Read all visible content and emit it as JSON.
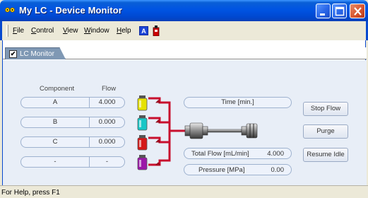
{
  "window": {
    "title": "My LC - Device Monitor"
  },
  "menu": {
    "items": [
      "File",
      "Control",
      "View",
      "Window",
      "Help"
    ],
    "icon1_glyph": "A"
  },
  "tab": {
    "label": "LC Monitor",
    "checked": true
  },
  "monitor": {
    "headers": {
      "component": "Component",
      "flow": "Flow"
    },
    "rows": [
      {
        "component": "A",
        "flow": "4.000",
        "color": "#e6e200"
      },
      {
        "component": "B",
        "flow": "0.000",
        "color": "#18c7c7"
      },
      {
        "component": "C",
        "flow": "0.000",
        "color": "#d41818"
      },
      {
        "component": "-",
        "flow": "-",
        "color": "#9b18a8"
      }
    ],
    "time_label": "Time [min.]",
    "total_flow_label": "Total Flow [mL/min]",
    "total_flow_value": "4.000",
    "pressure_label": "Pressure [MPa]",
    "pressure_value": "0.00"
  },
  "buttons": {
    "stop_flow": "Stop Flow",
    "purge": "Purge",
    "resume_idle": "Resume Idle"
  },
  "status": {
    "text": "For Help, press F1"
  },
  "colors": {
    "title_bar": "#0054e3",
    "tab": "#7f98b4",
    "panel": "#e8eef7",
    "piping": "#c8102e"
  }
}
